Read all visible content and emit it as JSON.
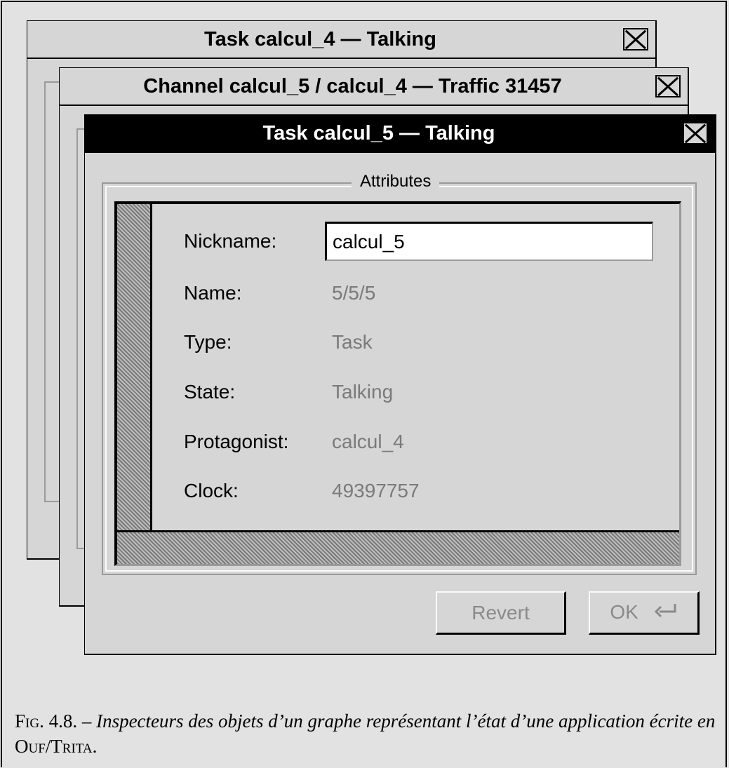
{
  "windows": {
    "back": {
      "title": "Task calcul_4 — Talking"
    },
    "middle": {
      "title": "Channel calcul_5 / calcul_4 — Traffic 31457"
    },
    "front": {
      "title": "Task calcul_5 — Talking",
      "group_label": "Attributes",
      "fields": {
        "nickname_label": "Nickname:",
        "nickname_value": "calcul_5",
        "name_label": "Name:",
        "name_value": "5/5/5",
        "type_label": "Type:",
        "type_value": "Task",
        "state_label": "State:",
        "state_value": "Talking",
        "protagonist_label": "Protagonist:",
        "protagonist_value": "calcul_4",
        "clock_label": "Clock:",
        "clock_value": "49397757"
      },
      "buttons": {
        "revert": "Revert",
        "ok": "OK"
      }
    }
  },
  "icons": {
    "close": "close-icon",
    "enter": "enter-icon"
  },
  "caption": {
    "fig_prefix": "Fig. 4.8. –",
    "text_part1": "Inspecteurs des objets d’un graphe représentant l’état d’une application écrite en",
    "system_name": "Ouf/Trita",
    "end": "."
  }
}
